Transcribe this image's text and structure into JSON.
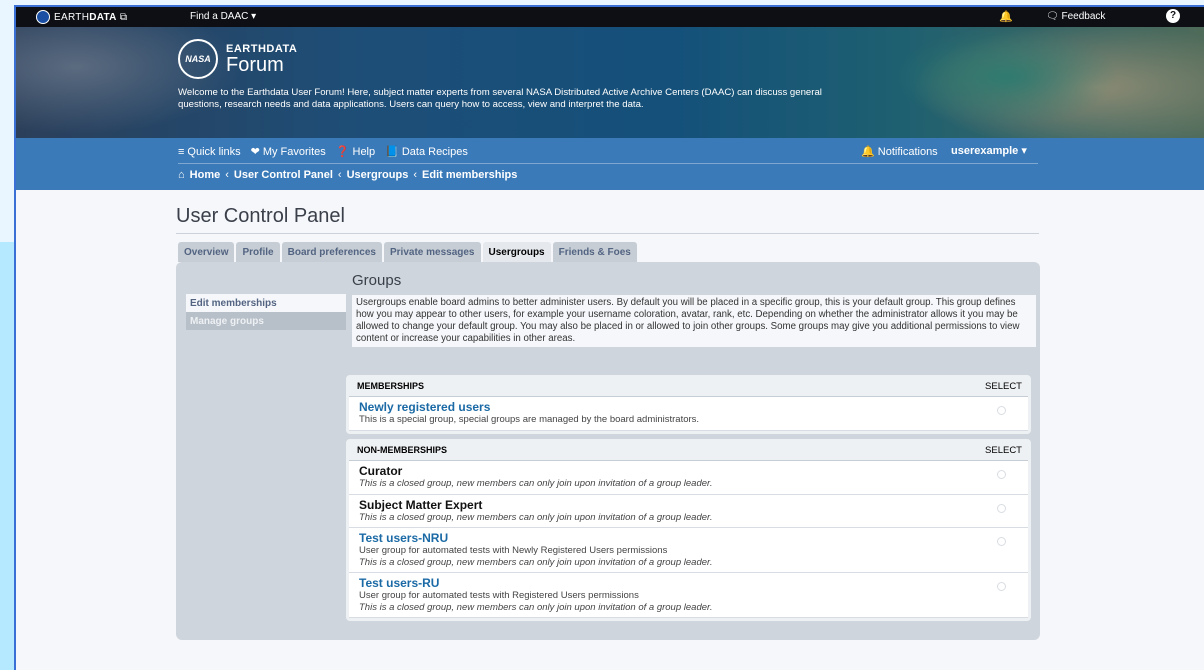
{
  "globalbar": {
    "brand_prefix": "EARTH",
    "brand_bold": "DATA",
    "brand_ext": "⧉",
    "find_daac": "Find a DAAC ▾",
    "feedback": "Feedback",
    "help": "?"
  },
  "hero": {
    "logo_badge": "NASA",
    "logo_line1": "EARTHDATA",
    "logo_line2": "Forum",
    "intro": "Welcome to the Earthdata User Forum! Here, subject matter experts from several NASA Distributed Active Archive Centers (DAAC) can discuss general questions, research needs and data applications. Users can query how to access, view and interpret the data."
  },
  "nav": {
    "quick_links": "Quick links",
    "favorites": "My Favorites",
    "help": "Help",
    "recipes": "Data Recipes",
    "notifications": "Notifications",
    "username": "userexample"
  },
  "breadcrumb": [
    "Home",
    "User Control Panel",
    "Usergroups",
    "Edit memberships"
  ],
  "page_title": "User Control Panel",
  "tabs": [
    "Overview",
    "Profile",
    "Board preferences",
    "Private messages",
    "Usergroups",
    "Friends & Foes"
  ],
  "side_menu": [
    "Edit memberships",
    "Manage groups"
  ],
  "groups": {
    "heading": "Groups",
    "description": "Usergroups enable board admins to better administer users. By default you will be placed in a specific group, this is your default group. This group defines how you may appear to other users, for example your username coloration, avatar, rank, etc. Depending on whether the administrator allows it you may be allowed to change your default group. You may also be placed in or allowed to join other groups. Some groups may give you additional permissions to view content or increase your capabilities in other areas."
  },
  "memberships": {
    "header": "MEMBERSHIPS",
    "select": "SELECT",
    "rows": [
      {
        "name": "Newly registered users",
        "desc": "This is a special group, special groups are managed by the board administrators."
      }
    ]
  },
  "non_memberships": {
    "header": "NON-MEMBERSHIPS",
    "select": "SELECT",
    "rows": [
      {
        "name": "Curator",
        "desc": "This is a closed group, new members can only join upon invitation of a group leader."
      },
      {
        "name": "Subject Matter Expert",
        "desc": "This is a closed group, new members can only join upon invitation of a group leader."
      },
      {
        "name": "Test users-NRU",
        "desc1": "User group for automated tests with Newly Registered Users permissions",
        "desc": "This is a closed group, new members can only join upon invitation of a group leader."
      },
      {
        "name": "Test users-RU",
        "desc1": "User group for automated tests with Registered Users permissions",
        "desc": "This is a closed group, new members can only join upon invitation of a group leader."
      }
    ]
  },
  "colors": {
    "navbar": "#3b7ab8",
    "link": "#1b6aa5",
    "panel": "#cfd5dc"
  }
}
